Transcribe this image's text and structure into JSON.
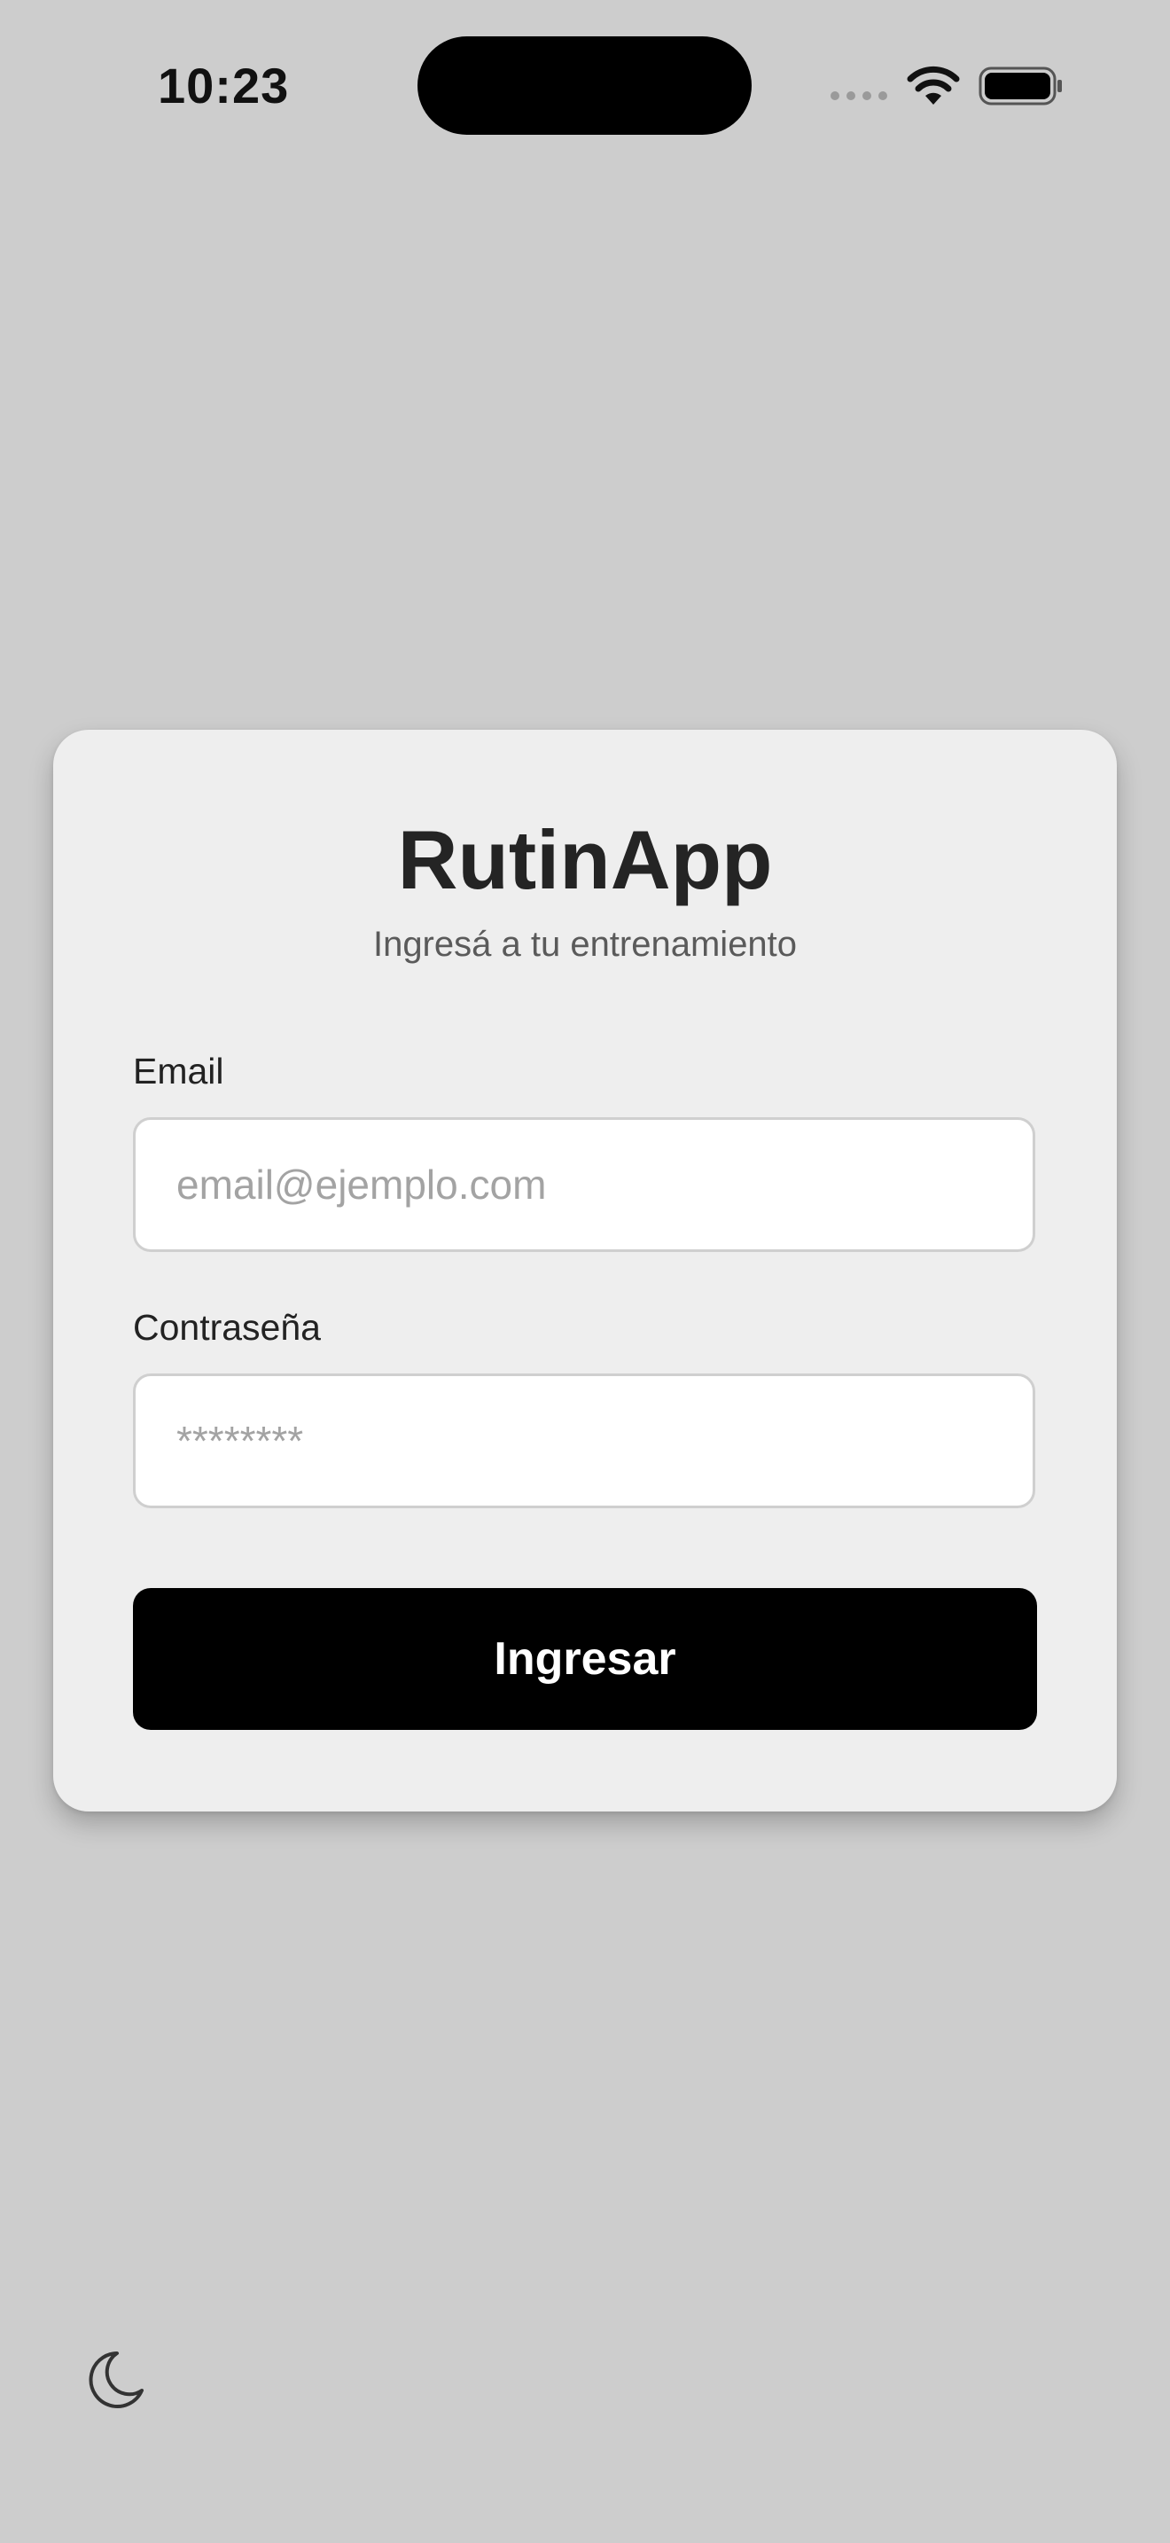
{
  "status_bar": {
    "time": "10:23"
  },
  "login": {
    "title": "RutinApp",
    "subtitle": "Ingresá a tu entrenamiento",
    "email_label": "Email",
    "email_placeholder": "email@ejemplo.com",
    "password_label": "Contraseña",
    "password_placeholder": "********",
    "submit_label": "Ingresar"
  },
  "theme_toggle": {
    "icon": "moon-icon"
  },
  "colors": {
    "background": "#cdcdcd",
    "card": "#eeeeee",
    "button": "#000000",
    "button_text": "#ffffff"
  }
}
